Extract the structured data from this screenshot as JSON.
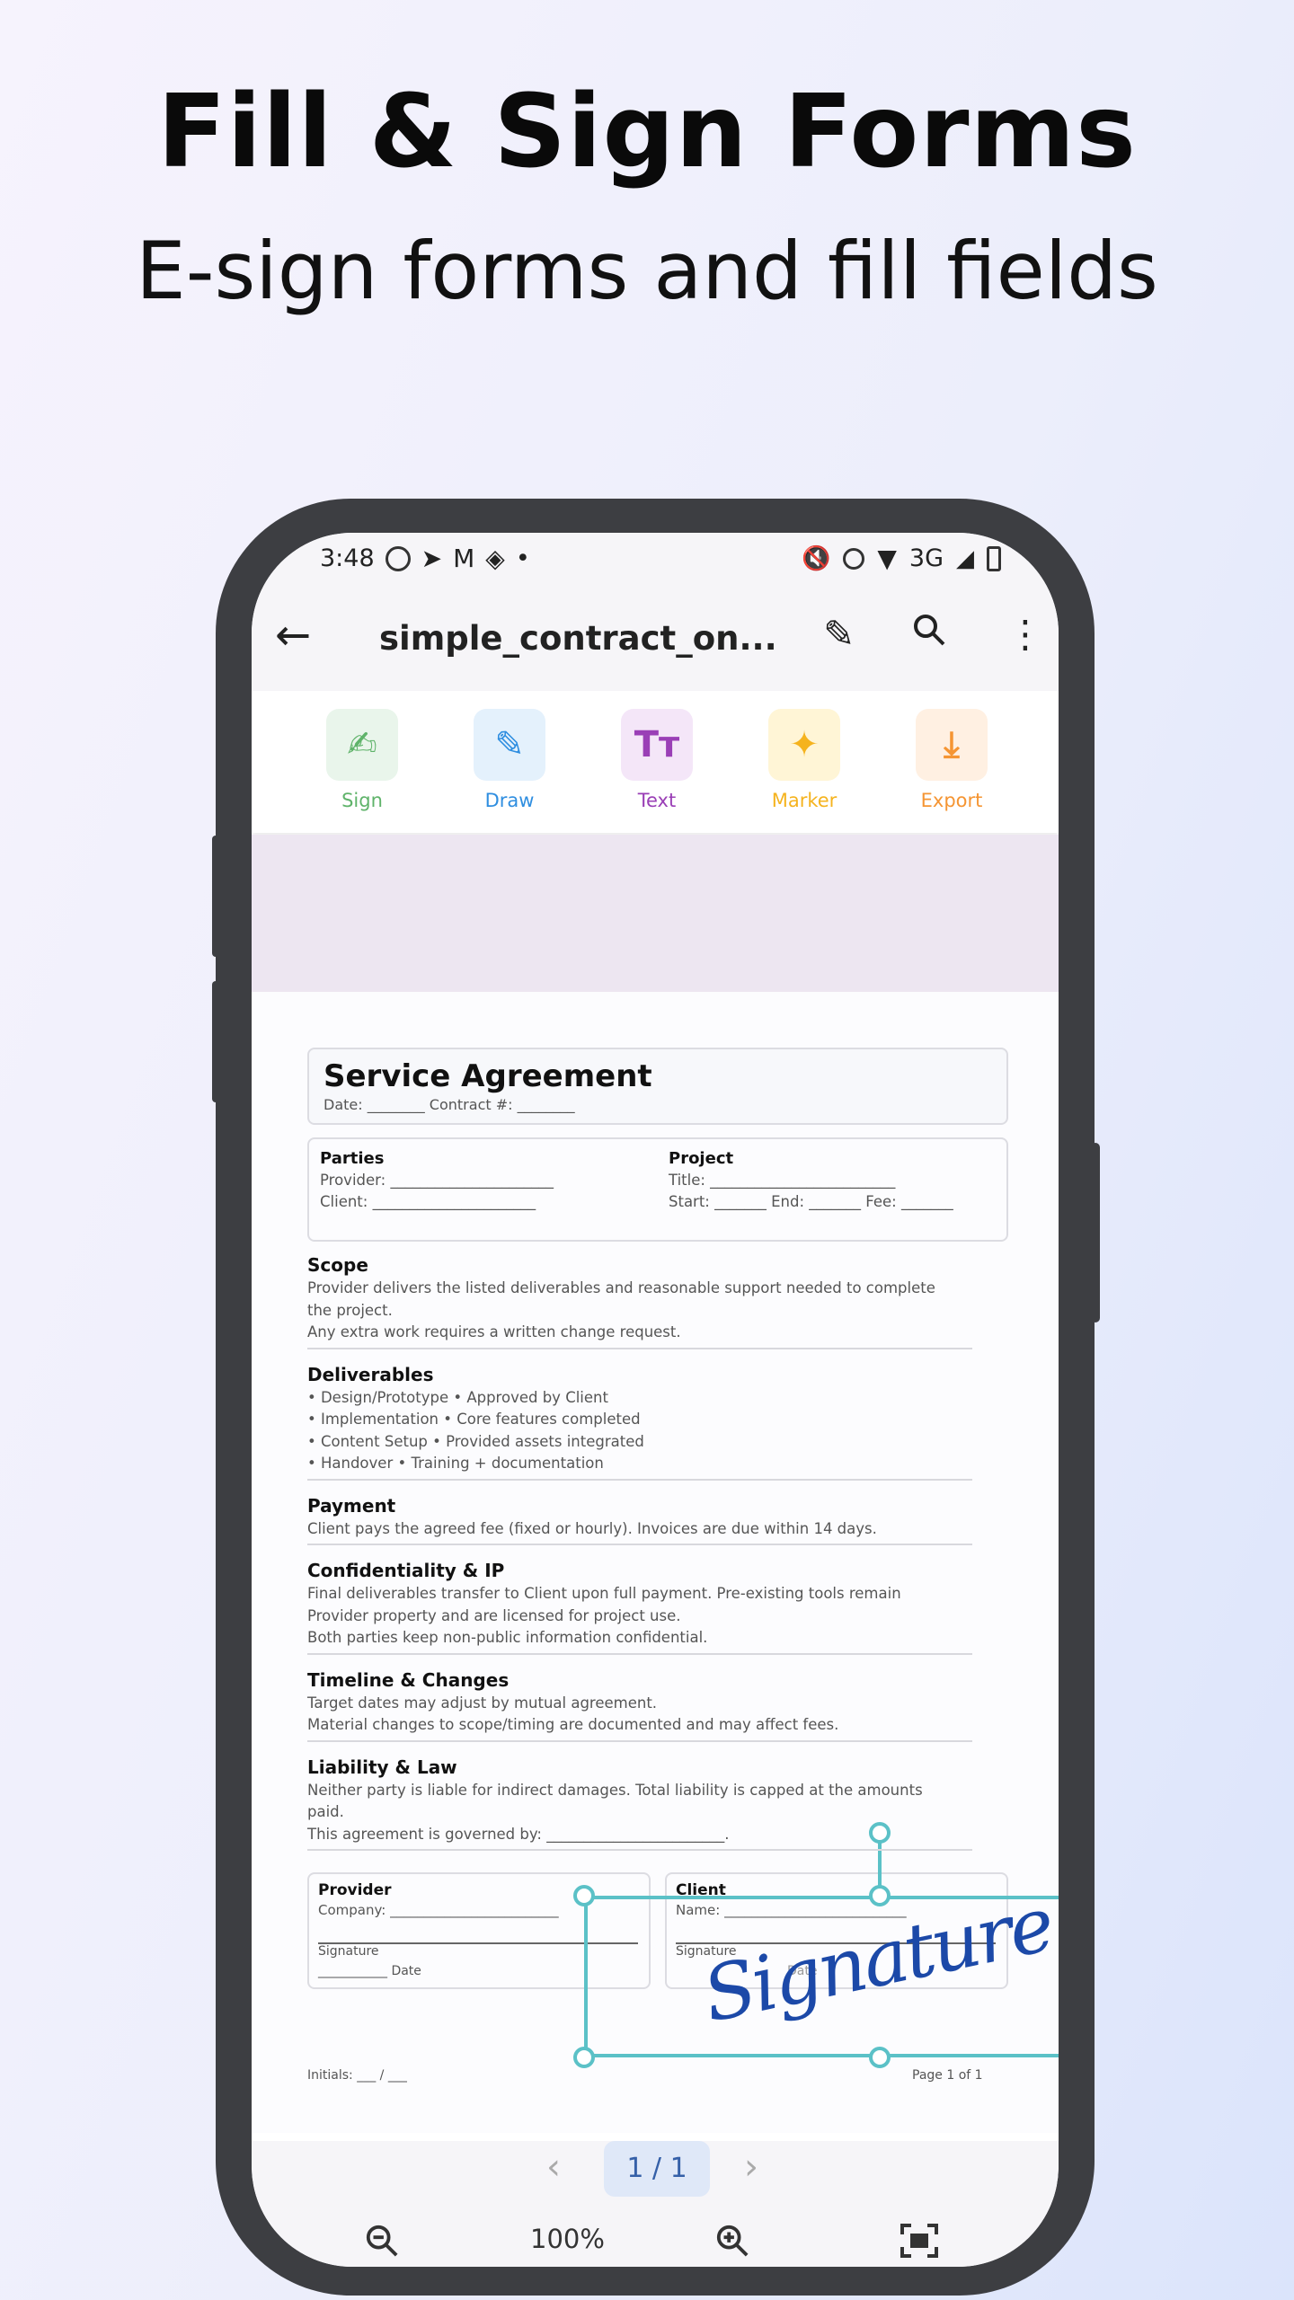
{
  "hero": {
    "title": "Fill & Sign Forms",
    "subtitle": "E-sign forms and fill fields"
  },
  "status": {
    "time": "3:48",
    "network": "3G"
  },
  "appbar": {
    "title": "simple_contract_on..."
  },
  "tools": [
    {
      "label": "Sign",
      "color": "#5fb36a",
      "bg": "#e9f5eb",
      "glyph": "✍"
    },
    {
      "label": "Draw",
      "color": "#2f8ee0",
      "bg": "#e4f1fc",
      "glyph": "✎"
    },
    {
      "label": "Text",
      "color": "#9a3fb6",
      "bg": "#f4e6f8",
      "glyph": "Tт"
    },
    {
      "label": "Marker",
      "color": "#f5b31e",
      "bg": "#fff5d6",
      "glyph": "✦"
    },
    {
      "label": "Export",
      "color": "#f59533",
      "bg": "#fff0e2",
      "glyph": "⤓"
    }
  ],
  "doc": {
    "title": "Service Agreement",
    "header_fields": "Date: ________    Contract #: ________",
    "parties": {
      "heading": "Parties",
      "provider": "Provider: ______________________",
      "client": "Client:    ______________________"
    },
    "project": {
      "heading": "Project",
      "title": "Title: _________________________",
      "dates": "Start: _______    End: _______    Fee: _______"
    },
    "sections": [
      {
        "heading": "Scope",
        "lines": [
          "Provider delivers the listed deliverables and reasonable support needed to complete",
          "the project.",
          "Any extra work requires a written change request."
        ]
      },
      {
        "heading": "Deliverables",
        "lines": [
          "• Design/Prototype • Approved by Client",
          "• Implementation • Core features completed",
          "• Content Setup • Provided assets integrated",
          "• Handover • Training + documentation"
        ]
      },
      {
        "heading": "Payment",
        "lines": [
          "Client pays the agreed fee (fixed or hourly). Invoices are due within 14 days."
        ]
      },
      {
        "heading": "Confidentiality & IP",
        "lines": [
          "Final deliverables transfer to Client upon full payment. Pre-existing tools remain",
          "Provider property and are licensed for project use.",
          "Both parties keep non-public information confidential."
        ]
      },
      {
        "heading": "Timeline & Changes",
        "lines": [
          "Target dates may adjust by mutual agreement.",
          "Material changes to scope/timing are documented and may affect fees."
        ]
      },
      {
        "heading": "Liability & Law",
        "lines": [
          "Neither party is liable for indirect damages. Total liability is capped at the amounts",
          "paid.",
          "This agreement is governed by: ________________________."
        ]
      }
    ],
    "provider_box": {
      "heading": "Provider",
      "company": "Company: _________________________",
      "signature": "Signature",
      "date": "___________ Date"
    },
    "client_box": {
      "heading": "Client",
      "name": "Name: ___________________________",
      "signature": "Signature",
      "date": "Date"
    },
    "initials": "Initials: ___ / ___",
    "page_of": "Page 1 of 1",
    "signature_text": "Signature"
  },
  "bottombar": {
    "page": "1 / 1",
    "zoom": "100%"
  }
}
